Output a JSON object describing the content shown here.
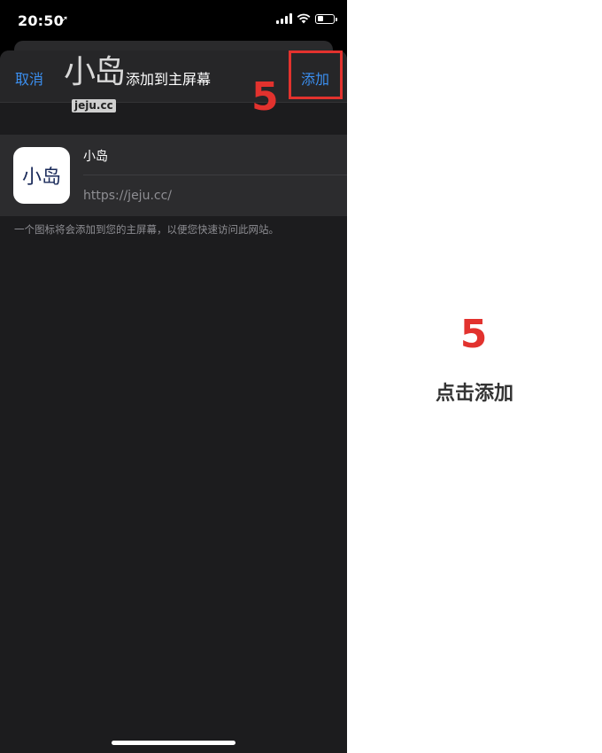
{
  "status_bar": {
    "time": "20:50"
  },
  "sheet": {
    "cancel_label": "取消",
    "title": "添加到主屏幕",
    "add_label": "添加"
  },
  "watermark": {
    "logo_text": "小岛",
    "url": "jeju.cc"
  },
  "web_clip": {
    "icon_text": "小岛",
    "name": "小岛",
    "url": "https://jeju.cc/"
  },
  "helper_text": "一个图标将会添加到您的主屏幕，以便您快速访问此网站。",
  "annotation": {
    "step_number": "5",
    "caption": "点击添加",
    "highlight_color": "#e2322e"
  },
  "colors": {
    "accent": "#3b8ff0",
    "sheet_bg": "#1c1c1e",
    "card_bg": "#2c2c2e"
  }
}
